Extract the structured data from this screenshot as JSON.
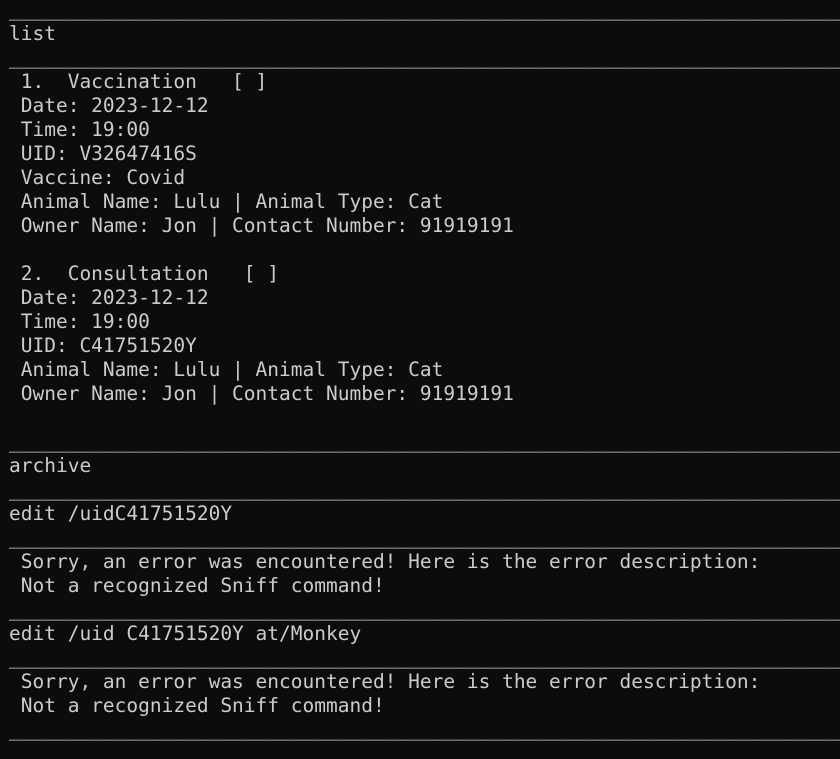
{
  "terminal": {
    "lines": [
      "_____________________________________________________________________________",
      "list",
      "_____________________________________________________________________________",
      " 1.  Vaccination   [ ]",
      " Date: 2023-12-12",
      " Time: 19:00",
      " UID: V32647416S",
      " Vaccine: Covid",
      " Animal Name: Lulu | Animal Type: Cat",
      " Owner Name: Jon | Contact Number: 91919191",
      "",
      " 2.  Consultation   [ ]",
      " Date: 2023-12-12",
      " Time: 19:00",
      " UID: C41751520Y",
      " Animal Name: Lulu | Animal Type: Cat",
      " Owner Name: Jon | Contact Number: 91919191",
      "",
      "_____________________________________________________________________________",
      "archive",
      "_____________________________________________________________________________",
      "edit /uidC41751520Y",
      "_____________________________________________________________________________",
      " Sorry, an error was encountered! Here is the error description:",
      " Not a recognized Sniff command!",
      "_____________________________________________________________________________",
      "edit /uid C41751520Y at/Monkey",
      "_____________________________________________________________________________",
      " Sorry, an error was encountered! Here is the error description:",
      " Not a recognized Sniff command!",
      "_____________________________________________________________________________"
    ]
  }
}
